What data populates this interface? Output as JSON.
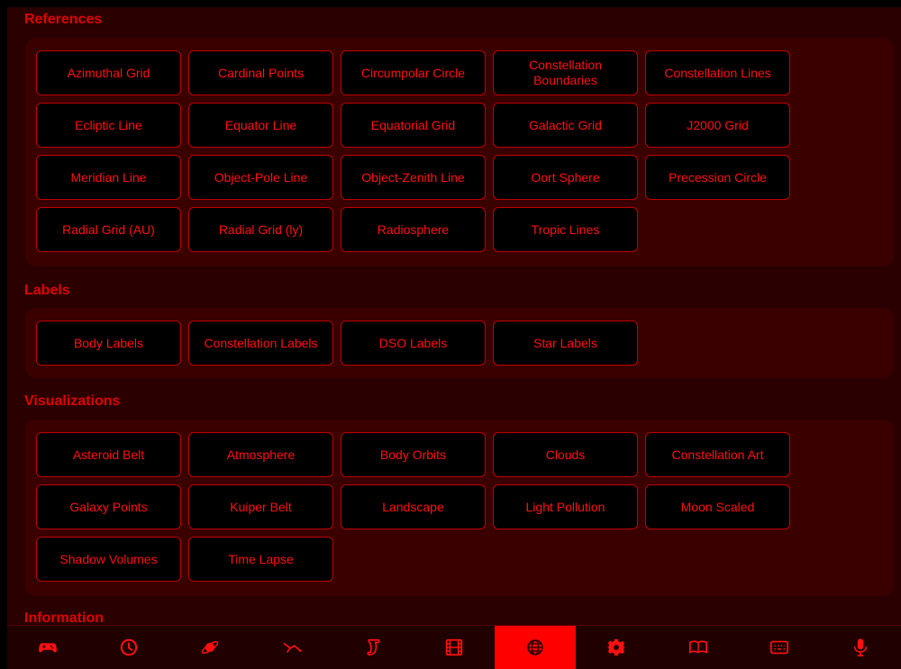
{
  "sections": {
    "references": {
      "title": "References",
      "buttons": [
        "Azimuthal Grid",
        "Cardinal Points",
        "Circumpolar Circle",
        "Constellation Boundaries",
        "Constellation Lines",
        "Ecliptic Line",
        "Equator Line",
        "Equatorial Grid",
        "Galactic Grid",
        "J2000 Grid",
        "Meridian Line",
        "Object-Pole Line",
        "Object-Zenith Line",
        "Oort Sphere",
        "Precession Circle",
        "Radial Grid (AU)",
        "Radial Grid (ly)",
        "Radiosphere",
        "Tropic Lines"
      ]
    },
    "labels": {
      "title": "Labels",
      "buttons": [
        "Body Labels",
        "Constellation Labels",
        "DSO Labels",
        "Star Labels"
      ]
    },
    "visualizations": {
      "title": "Visualizations",
      "buttons": [
        "Asteroid Belt",
        "Atmosphere",
        "Body Orbits",
        "Clouds",
        "Constellation Art",
        "Galaxy Points",
        "Kuiper Belt",
        "Landscape",
        "Light Pollution",
        "Moon Scaled",
        "Shadow Volumes",
        "Time Lapse"
      ]
    },
    "information": {
      "title": "Information"
    }
  },
  "tabbar": {
    "tabs": [
      {
        "icon": "gamepad-icon"
      },
      {
        "icon": "clock-icon"
      },
      {
        "icon": "planet-icon"
      },
      {
        "icon": "constellation-icon"
      },
      {
        "icon": "scroll-icon"
      },
      {
        "icon": "film-icon"
      },
      {
        "icon": "globe-icon",
        "active": true
      },
      {
        "icon": "gear-icon"
      },
      {
        "icon": "book-icon"
      },
      {
        "icon": "keyboard-icon"
      },
      {
        "icon": "microphone-icon"
      }
    ]
  },
  "colors": {
    "accent": "#ff0000",
    "background": "#2a0000",
    "panel": "#3a0000",
    "button": "#000000"
  }
}
